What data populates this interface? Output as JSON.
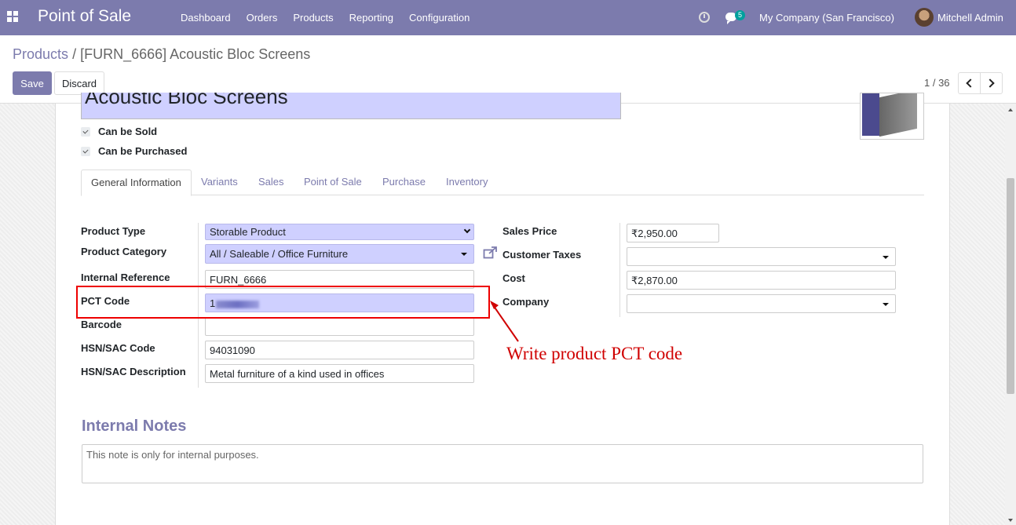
{
  "navbar": {
    "app_title": "Point of Sale",
    "menu": [
      "Dashboard",
      "Orders",
      "Products",
      "Reporting",
      "Configuration"
    ],
    "chat_count": "5",
    "company": "My Company (San Francisco)",
    "user": "Mitchell Admin"
  },
  "breadcrumb": {
    "parent": "Products",
    "separator": "/",
    "current": "[FURN_6666] Acoustic Bloc Screens"
  },
  "toolbar": {
    "save_label": "Save",
    "discard_label": "Discard"
  },
  "pager": {
    "value": "1 / 36"
  },
  "product": {
    "name": "Acoustic Bloc Screens",
    "can_be_sold_label": "Can be Sold",
    "can_be_purchased_label": "Can be Purchased"
  },
  "tabs": [
    "General Information",
    "Variants",
    "Sales",
    "Point of Sale",
    "Purchase",
    "Inventory"
  ],
  "left_fields": {
    "product_type": {
      "label": "Product Type",
      "value": "Storable Product"
    },
    "product_category": {
      "label": "Product Category",
      "value": "All / Saleable / Office Furniture"
    },
    "internal_reference": {
      "label": "Internal Reference",
      "value": "FURN_6666"
    },
    "pct_code": {
      "label": "PCT Code",
      "value": "1"
    },
    "barcode": {
      "label": "Barcode",
      "value": ""
    },
    "hsn_code": {
      "label": "HSN/SAC Code",
      "value": "94031090"
    },
    "hsn_description": {
      "label": "HSN/SAC Description",
      "value": "Metal furniture of a kind used in offices"
    }
  },
  "right_fields": {
    "sales_price": {
      "label": "Sales Price",
      "value": "₹2,950.00"
    },
    "customer_taxes": {
      "label": "Customer Taxes",
      "value": ""
    },
    "cost": {
      "label": "Cost",
      "value": "₹2,870.00"
    },
    "company": {
      "label": "Company",
      "value": ""
    }
  },
  "annotation": {
    "text": "Write product PCT code",
    "color": "#d00000"
  },
  "notes": {
    "title": "Internal Notes",
    "placeholder": "This note is only for internal purposes."
  },
  "colors": {
    "brand": "#7c7bad",
    "selection_fill": "#cfd0ff"
  }
}
